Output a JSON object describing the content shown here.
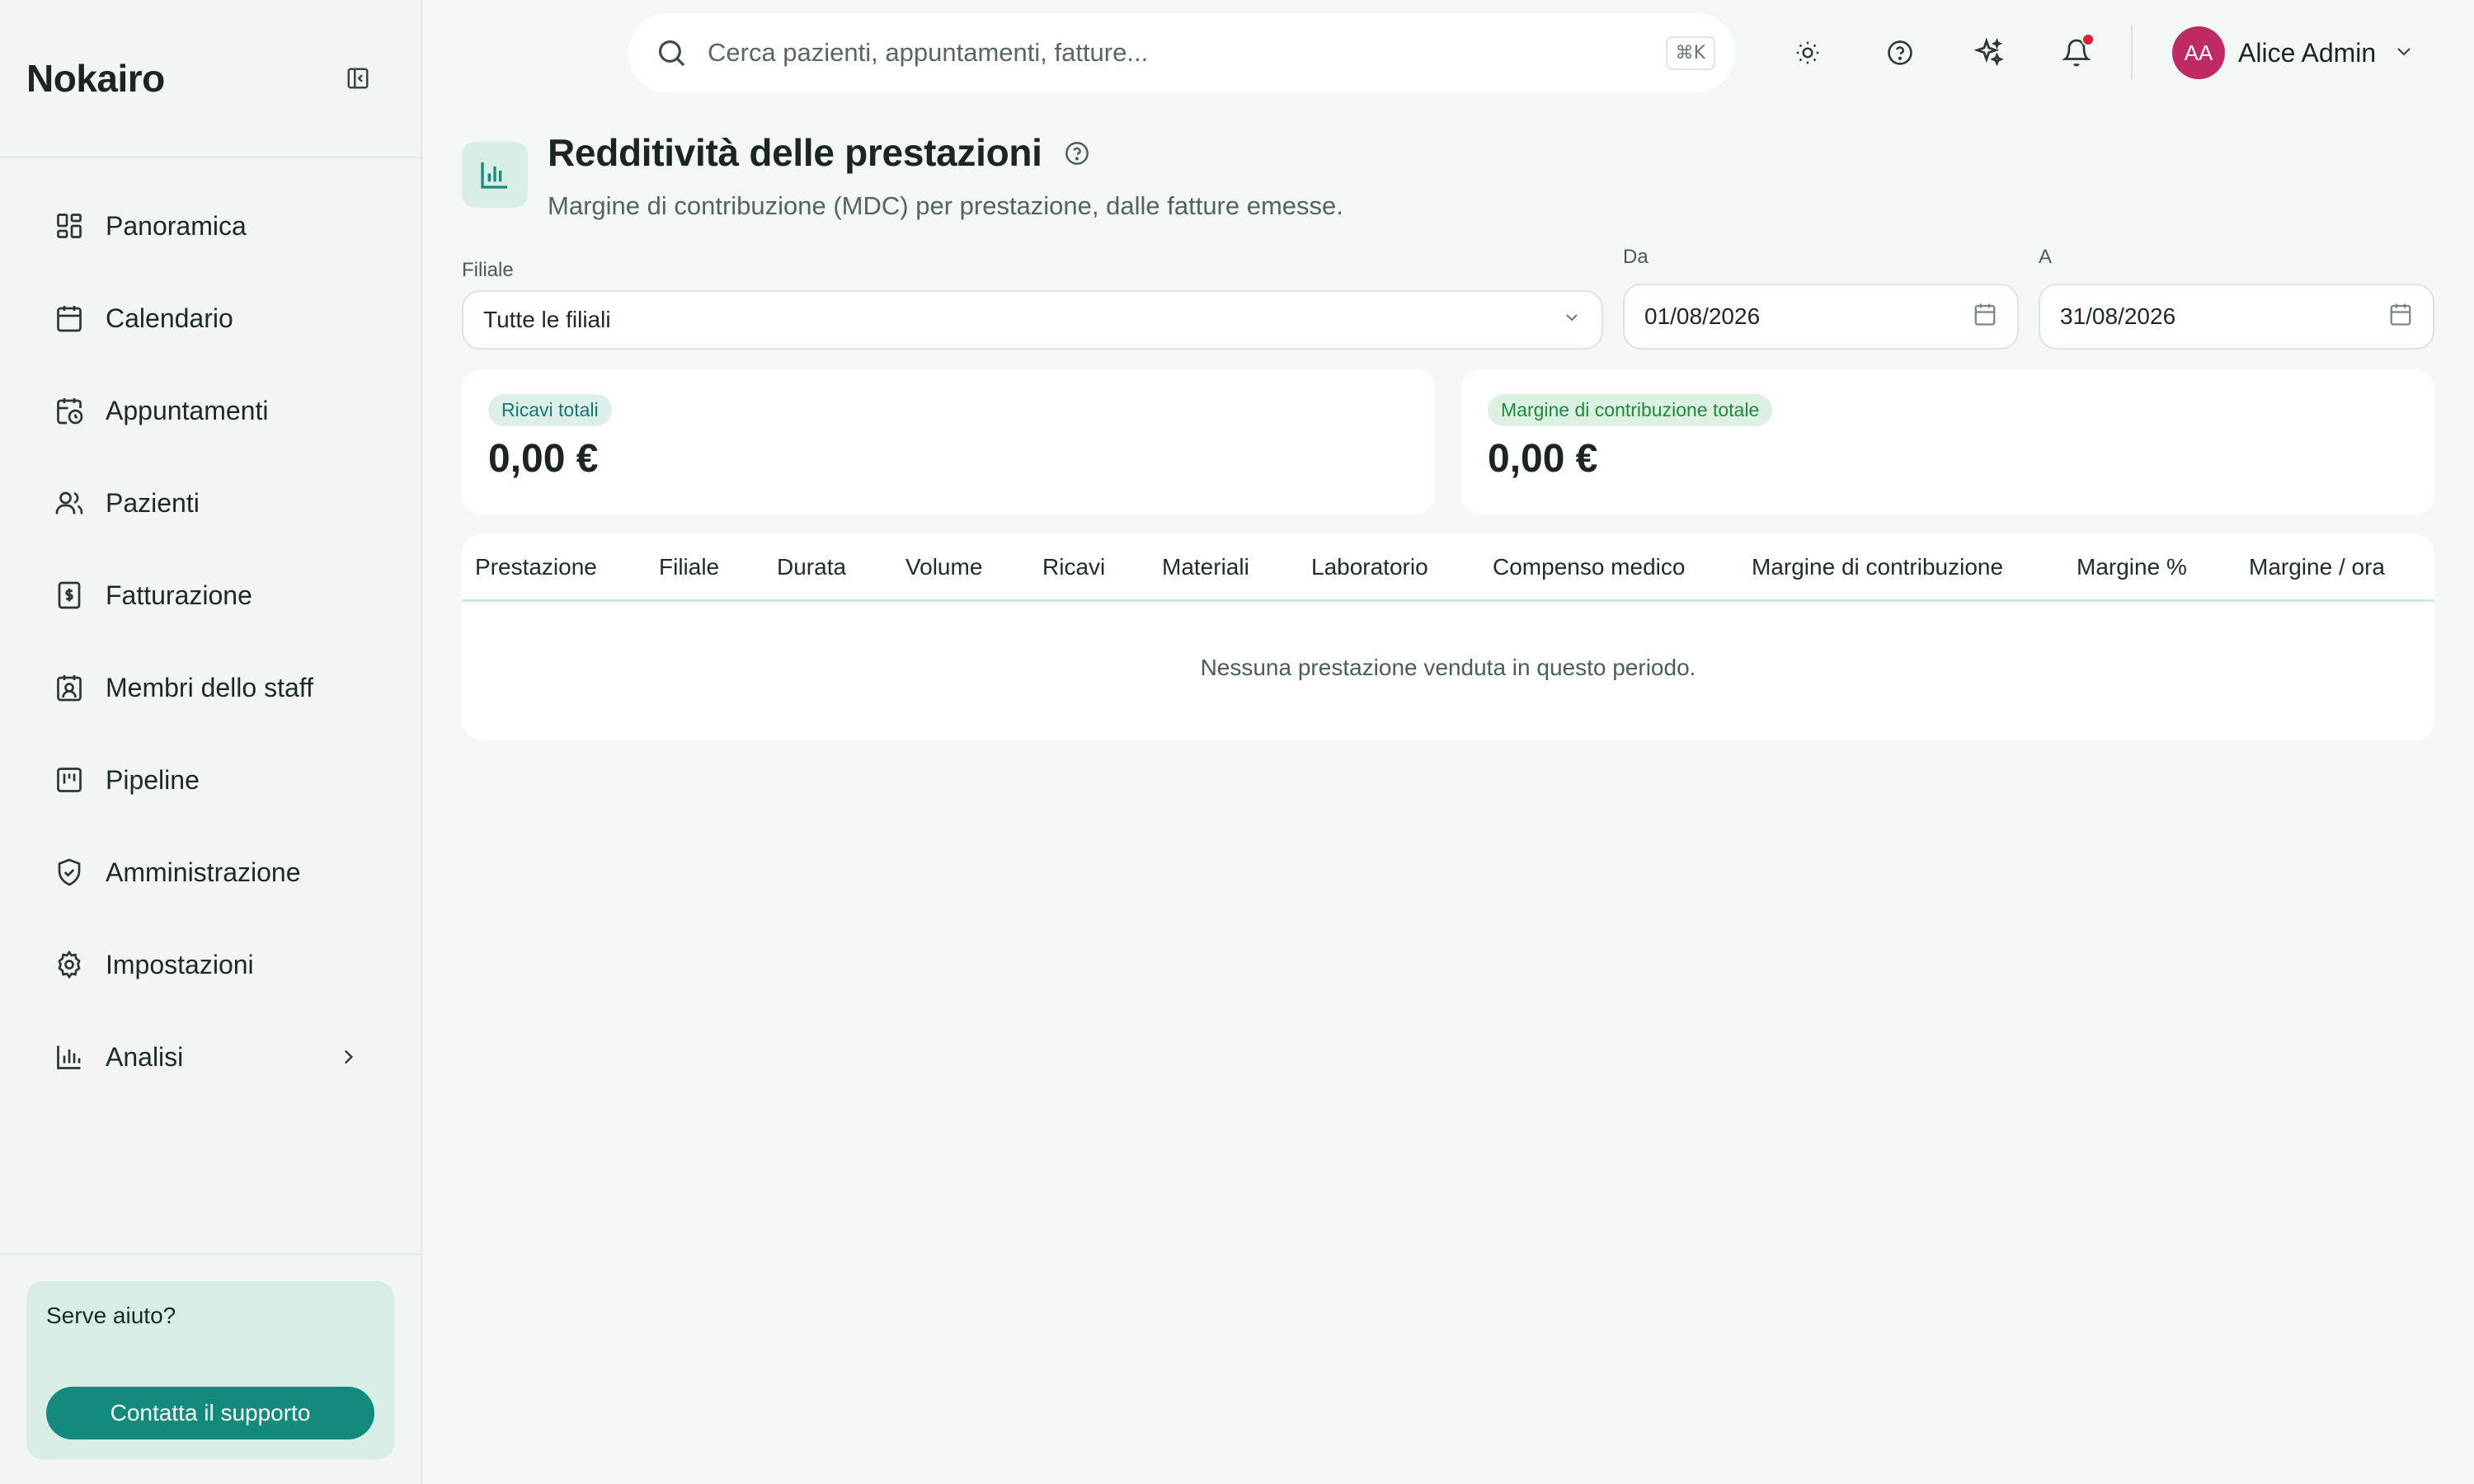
{
  "app": {
    "name": "Nokairo"
  },
  "sidebar": {
    "items": [
      {
        "label": "Panoramica",
        "icon": "grid-icon"
      },
      {
        "label": "Calendario",
        "icon": "calendar-icon"
      },
      {
        "label": "Appuntamenti",
        "icon": "calendar-clock-icon"
      },
      {
        "label": "Pazienti",
        "icon": "users-icon"
      },
      {
        "label": "Fatturazione",
        "icon": "invoice-icon"
      },
      {
        "label": "Membri dello staff",
        "icon": "badge-icon"
      },
      {
        "label": "Pipeline",
        "icon": "kanban-icon"
      },
      {
        "label": "Amministrazione",
        "icon": "shield-check-icon"
      },
      {
        "label": "Impostazioni",
        "icon": "gear-icon"
      },
      {
        "label": "Analisi",
        "icon": "bar-chart-icon"
      }
    ],
    "help": {
      "title": "Serve aiuto?",
      "button": "Contatta il supporto"
    }
  },
  "topbar": {
    "search_placeholder": "Cerca pazienti, appuntamenti, fatture...",
    "shortcut": "⌘K",
    "user": {
      "initials": "AA",
      "name": "Alice Admin"
    }
  },
  "page": {
    "title": "Redditività delle prestazioni",
    "subtitle": "Margine di contribuzione (MDC) per prestazione, dalle fatture emesse."
  },
  "filters": {
    "branch_label": "Filiale",
    "branch_value": "Tutte le filiali",
    "from_label": "Da",
    "from_value": "01/08/2026",
    "to_label": "A",
    "to_value": "31/08/2026"
  },
  "summary": {
    "revenue_label": "Ricavi totali",
    "revenue_value": "0,00 €",
    "margin_label": "Margine di contribuzione totale",
    "margin_value": "0,00 €"
  },
  "table": {
    "columns": [
      "Prestazione",
      "Filiale",
      "Durata",
      "Volume",
      "Ricavi",
      "Materiali",
      "Laboratorio",
      "Compenso medico",
      "Margine di contribuzione",
      "Margine %",
      "Margine / ora"
    ],
    "empty": "Nessuna prestazione venduta in questo periodo."
  },
  "colors": {
    "accent": "#138a7b",
    "avatar": "#c02a63",
    "notification": "#e11d3c"
  }
}
